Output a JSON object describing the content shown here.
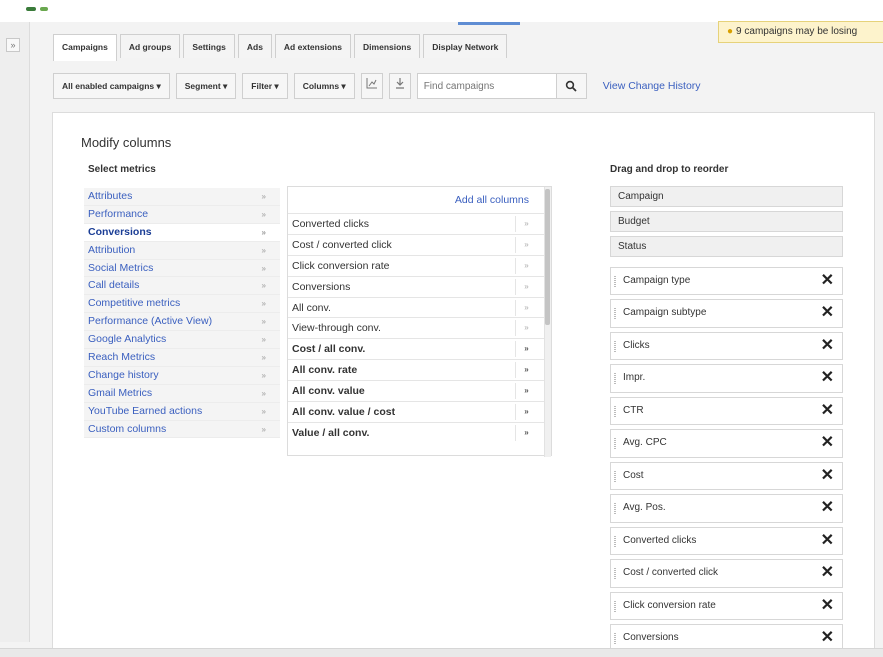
{
  "notification": {
    "text": "9 campaigns may be losing"
  },
  "tabs": [
    {
      "label": "Campaigns"
    },
    {
      "label": "Ad groups"
    },
    {
      "label": "Settings"
    },
    {
      "label": "Ads"
    },
    {
      "label": "Ad extensions"
    },
    {
      "label": "Dimensions"
    },
    {
      "label": "Display Network"
    }
  ],
  "toolbar": {
    "campaign_filter": "All enabled campaigns ▾",
    "segment": "Segment ▾",
    "filter": "Filter ▾",
    "columns": "Columns ▾",
    "search_placeholder": "Find campaigns",
    "history_link": "View Change History"
  },
  "modal": {
    "title": "Modify columns",
    "select_metrics_label": "Select metrics",
    "reorder_label": "Drag and drop to reorder",
    "add_all": "Add all columns",
    "categories": [
      "Attributes",
      "Performance",
      "Conversions",
      "Attribution",
      "Social Metrics",
      "Call details",
      "Competitive metrics",
      "Performance (Active View)",
      "Google Analytics",
      "Reach Metrics",
      "Change history",
      "Gmail Metrics",
      "YouTube Earned actions",
      "Custom columns"
    ],
    "category_chevron": "»",
    "metrics": [
      "Converted clicks",
      "Cost / converted click",
      "Click conversion rate",
      "Conversions",
      "All conv.",
      "View-through conv.",
      "Cost / all conv.",
      "All conv. rate",
      "All conv. value",
      "All conv. value / cost",
      "Value / all conv."
    ],
    "metric_chevron": "»",
    "fixed_columns": [
      "Campaign",
      "Budget",
      "Status"
    ],
    "removable_columns": [
      "Campaign type",
      "Campaign subtype",
      "Clicks",
      "Impr.",
      "CTR",
      "Avg. CPC",
      "Cost",
      "Avg. Pos.",
      "Converted clicks",
      "Cost / converted click",
      "Click conversion rate",
      "Conversions"
    ],
    "remove_glyph": "✕"
  }
}
